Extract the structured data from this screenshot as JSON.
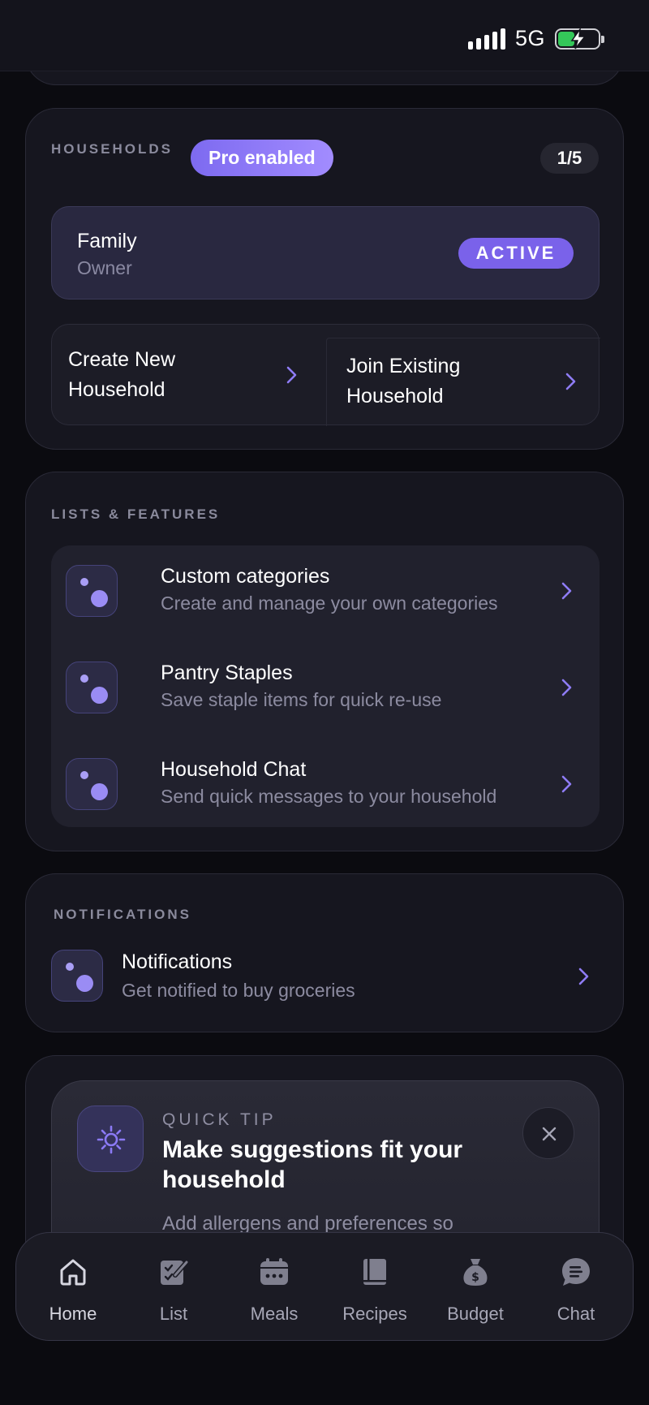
{
  "status_bar": {
    "network": "5G",
    "battery_charging": true,
    "colors": {
      "battery": "#34c759"
    }
  },
  "households": {
    "label": "HOUSEHOLDS",
    "pro_badge": "Pro enabled",
    "count": "1/5",
    "current": {
      "name": "Family",
      "role": "Owner",
      "status": "ACTIVE"
    },
    "actions": {
      "create": "Create New Household",
      "join": "Join Existing Household"
    }
  },
  "features": {
    "label": "LISTS & FEATURES",
    "items": [
      {
        "title": "Custom categories",
        "subtitle": "Create and manage your own categories"
      },
      {
        "title": "Pantry Staples",
        "subtitle": "Save staple items for quick re-use"
      },
      {
        "title": "Household Chat",
        "subtitle": "Send quick messages to your household"
      }
    ]
  },
  "notifications": {
    "label": "NOTIFICATIONS",
    "item": {
      "title": "Notifications",
      "subtitle": "Get notified to buy groceries"
    }
  },
  "quick_tip": {
    "label": "QUICK TIP",
    "title": "Make suggestions fit your household",
    "body": "Add allergens and preferences so"
  },
  "nav": {
    "items": [
      {
        "label": "Home",
        "icon": "home-icon"
      },
      {
        "label": "List",
        "icon": "list-icon"
      },
      {
        "label": "Meals",
        "icon": "meals-icon"
      },
      {
        "label": "Recipes",
        "icon": "recipes-icon"
      },
      {
        "label": "Budget",
        "icon": "budget-icon"
      },
      {
        "label": "Chat",
        "icon": "chat-icon"
      }
    ]
  },
  "theme": {
    "accent": "#7a62ea",
    "accent_light": "#a28cff",
    "background": "#0b0b10",
    "card": "#16161f"
  }
}
